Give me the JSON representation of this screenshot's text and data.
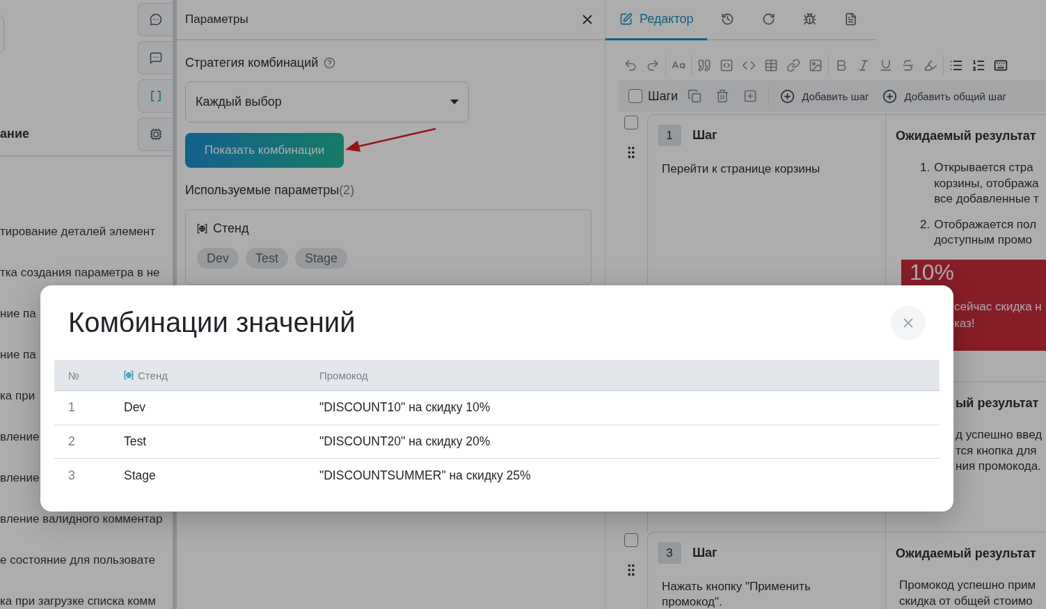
{
  "left_panel": {
    "header": "ание",
    "items": [
      "тирование деталей элемент",
      "тка создания параметра в не",
      "ние па",
      "ние па",
      "ка при",
      "вление",
      "вление",
      "вление валидного комментар",
      "е состояние для пользовате",
      "ка при загрузке списка комм"
    ]
  },
  "side_tools": [
    {
      "kind": "chat",
      "selected": false
    },
    {
      "kind": "chat-person",
      "selected": false
    },
    {
      "kind": "brackets",
      "selected": true
    },
    {
      "kind": "ai",
      "selected": false
    }
  ],
  "parameters_panel": {
    "title": "Параметры",
    "strategy_label": "Стратегия комбинаций",
    "strategy_value": "Каждый выбор",
    "show_button": "Показать комбинации",
    "used_label": "Используемые параметры",
    "used_count": "(2)",
    "parameters": [
      {
        "name": "Стенд",
        "values": [
          "Dev",
          "Test",
          "Stage"
        ]
      }
    ]
  },
  "editor": {
    "tabs": [
      {
        "kind": "editor",
        "label": "Редактор",
        "selected": true
      },
      {
        "kind": "history",
        "selected": false
      },
      {
        "kind": "refresh",
        "selected": false
      },
      {
        "kind": "bug",
        "selected": false
      },
      {
        "kind": "document",
        "selected": false
      }
    ],
    "steps_bar": {
      "label": "Шаги",
      "checked": false,
      "add_step": "Добавить шаг",
      "add_common_step": "Добавить общий шаг"
    },
    "steps": [
      {
        "number": "1",
        "title": "Шаг",
        "checked": false,
        "action": "Перейти к странице корзины",
        "expected_title": "Ожидаемый результат",
        "expected": [
          {
            "marker": "1.",
            "text": "Открывается стра\nкорзины, отобража\nвсе добавленные т"
          },
          {
            "marker": "2.",
            "text": "Отображается пол\nдоступным промо"
          }
        ],
        "banner": {
          "title": "10%",
          "text": "сейчас скидка н\nказ!"
        }
      },
      {
        "expected_title": "ый результат",
        "expected_text": "д успешно введ\nтся кнопка для\nния промокода."
      },
      {
        "number": "3",
        "title": "Шаг",
        "checked": false,
        "action": "Нажать кнопку \"Применить\nпромокод\".",
        "expected_title": "Ожидаемый результат",
        "expected_text": "Промокод успешно прим\nскидка от общей стоимо"
      }
    ]
  },
  "modal": {
    "title": "Комбинации значений",
    "columns": [
      {
        "kind": "index",
        "label": "№"
      },
      {
        "kind": "parameter",
        "label": "Стенд"
      },
      {
        "kind": "text",
        "label": "Промокод"
      }
    ],
    "rows": [
      [
        "1",
        "Dev",
        "\"DISCOUNT10\" на скидку 10%"
      ],
      [
        "2",
        "Test",
        "\"DISCOUNT20\" на скидку 20%"
      ],
      [
        "3",
        "Stage",
        "\"DISCOUNTSUMMER\" на скидку 25%"
      ]
    ]
  }
}
